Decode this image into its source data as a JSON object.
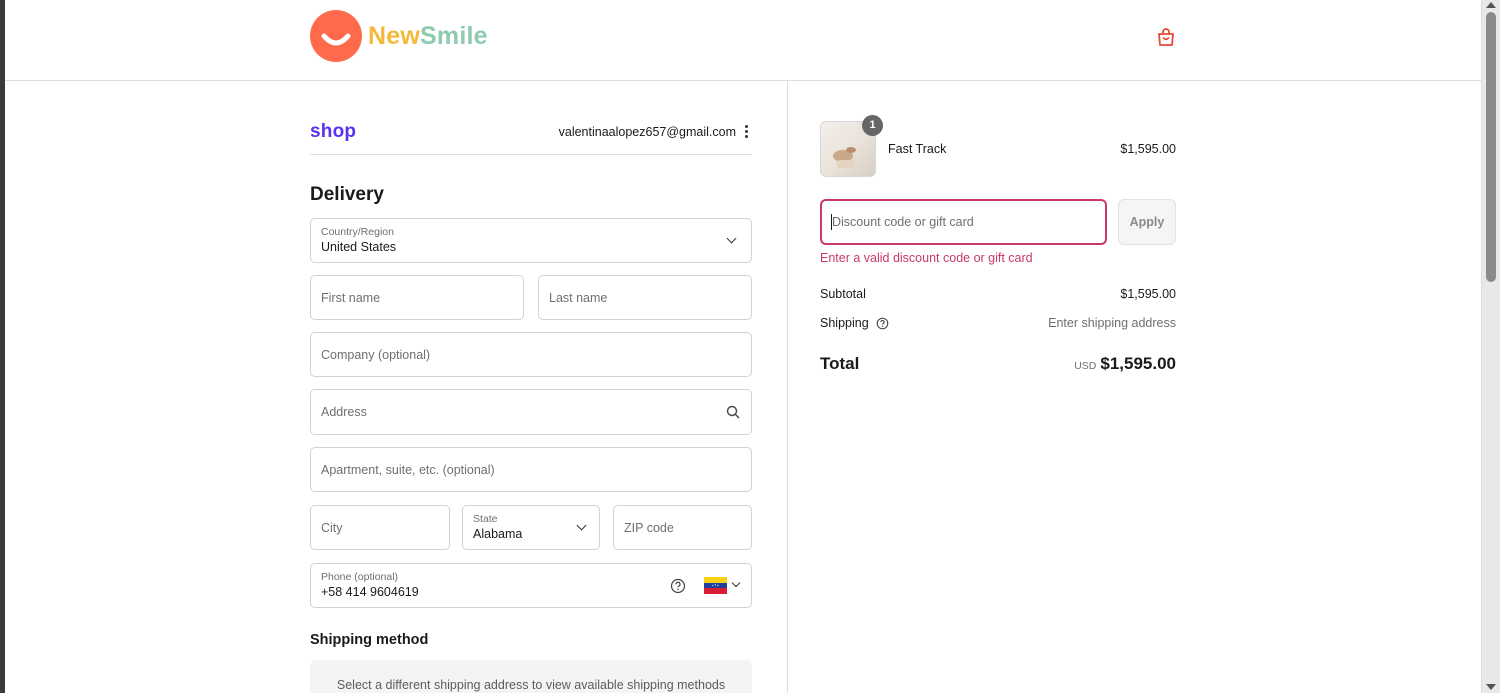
{
  "brand": {
    "name_part1": "New",
    "name_part2": "Smile"
  },
  "header": {
    "cart_icon": "shopping-bag-icon"
  },
  "account": {
    "shop_logo": "shop",
    "email": "valentinaalopez657@gmail.com"
  },
  "delivery": {
    "title": "Delivery",
    "country": {
      "label": "Country/Region",
      "value": "United States"
    },
    "first_name": {
      "placeholder": "First name"
    },
    "last_name": {
      "placeholder": "Last name"
    },
    "company": {
      "placeholder": "Company (optional)"
    },
    "address": {
      "placeholder": "Address"
    },
    "apartment": {
      "placeholder": "Apartment, suite, etc. (optional)"
    },
    "city": {
      "placeholder": "City"
    },
    "state": {
      "label": "State",
      "value": "Alabama"
    },
    "zip": {
      "placeholder": "ZIP code"
    },
    "phone": {
      "label": "Phone (optional)",
      "value": "+58 414 9604619",
      "country_flag": "venezuela-flag-icon"
    }
  },
  "shipping_method": {
    "title": "Shipping method",
    "message": "Select a different shipping address to view available shipping methods"
  },
  "order_summary": {
    "item": {
      "name": "Fast Track",
      "price": "$1,595.00",
      "quantity": "1"
    },
    "discount": {
      "placeholder": "Discount code or gift card",
      "apply_label": "Apply",
      "error": "Enter a valid discount code or gift card"
    },
    "subtotal_label": "Subtotal",
    "subtotal_value": "$1,595.00",
    "shipping_label": "Shipping",
    "shipping_value": "Enter shipping address",
    "total_label": "Total",
    "currency": "USD",
    "total_value": "$1,595.00"
  },
  "colors": {
    "brand_orange": "#ff6a4d",
    "shop_purple": "#5a31f4",
    "error_pink": "#c8386b"
  }
}
